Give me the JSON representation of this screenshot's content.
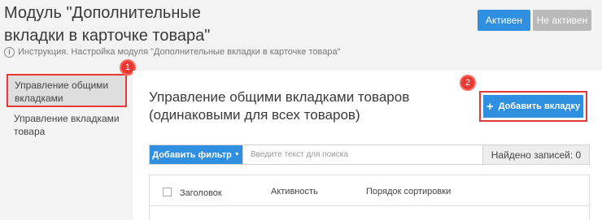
{
  "header": {
    "title": "Модуль \"Дополнительные вкладки в карточке товара\"",
    "status_active_label": "Активен",
    "status_inactive_label": "Не активен",
    "instruction_text": "Инструкция. Настройка модуля \"Дополнительные вкладки в карточке товара\"",
    "info_icon": "info-icon"
  },
  "sidebar": {
    "items": [
      {
        "label": "Управление общими вкладками",
        "active": true,
        "badge": "1"
      },
      {
        "label": "Управление вкладками товара",
        "active": false
      }
    ]
  },
  "main": {
    "title": "Управление общими вкладками товаров (одинаковыми для всех товаров)",
    "add_tab_label": "Добавить вкладку",
    "add_tab_badge": "2",
    "add_filter_label": "Добавить фильтр",
    "search_placeholder": "Введите текст для поиска",
    "records_found": "Найдено записей: 0",
    "table": {
      "columns": [
        "Заголовок",
        "Активность",
        "Порядок сортировки"
      ]
    }
  },
  "colors": {
    "accent": "#2f8fe0",
    "inactive": "#b9b9b9",
    "highlight": "#e53935"
  }
}
